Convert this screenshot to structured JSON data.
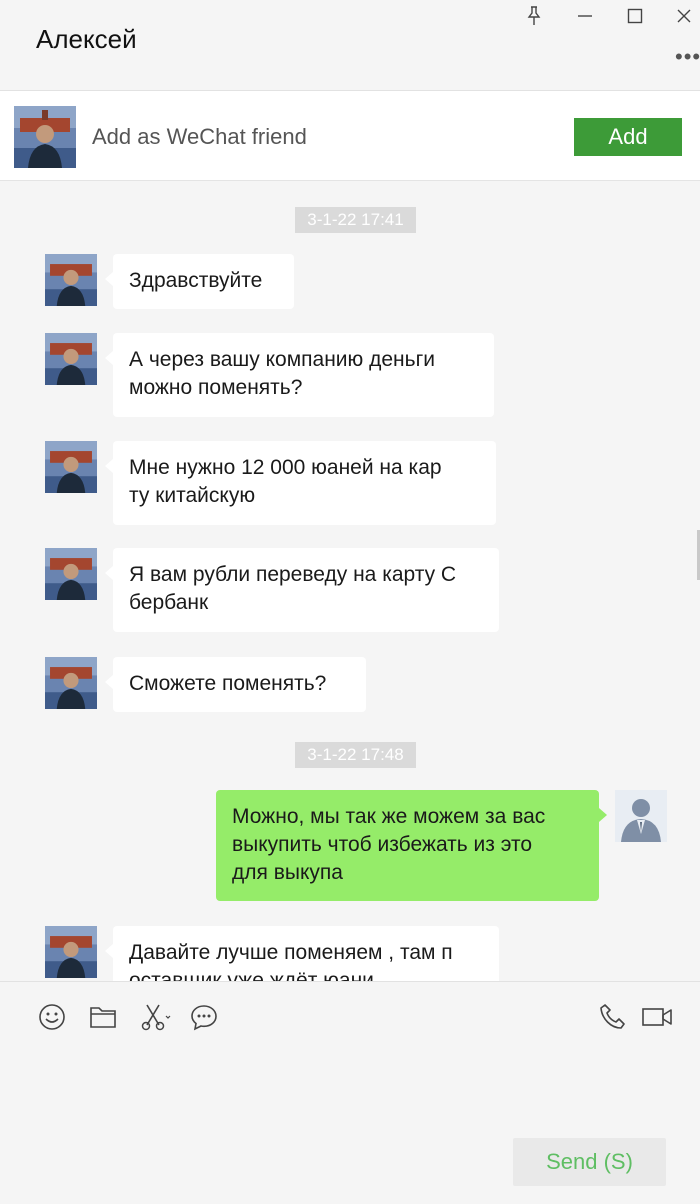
{
  "header": {
    "title": "Алексей",
    "more_label": "•••"
  },
  "icons": {
    "pin": "pin-icon",
    "minimize": "minimize-icon",
    "maximize": "maximize-icon",
    "close": "close-icon",
    "emoji": "emoji-icon",
    "folder": "folder-icon",
    "scissors": "scissors-icon",
    "chat_history": "chat-history-icon",
    "phone": "phone-icon",
    "video": "video-call-icon"
  },
  "add_friend": {
    "label": "Add as WeChat friend",
    "button": "Add"
  },
  "chat": {
    "timestamp_1": "3-1-22 17:41",
    "timestamp_2": "3-1-22 17:48",
    "messages": [
      {
        "from": "contact",
        "text": "Здравствуйте"
      },
      {
        "from": "contact",
        "text": "А через вашу компанию деньги\nможно поменять?"
      },
      {
        "from": "contact",
        "text": "Мне нужно 12 000 юаней на кар\nту китайскую"
      },
      {
        "from": "contact",
        "text": "Я вам рубли переведу на карту С\nбербанк"
      },
      {
        "from": "contact",
        "text": "Сможете поменять?"
      },
      {
        "from": "me",
        "text": "Можно, мы так же можем за вас\n выкупить чтоб избежать из это\nдля выкупа"
      },
      {
        "from": "contact",
        "text": "Давайте лучше поменяем , там п\nоставщик уже ждёт юани"
      }
    ]
  },
  "input": {
    "value": "",
    "send_label": "Send (S)"
  },
  "colors": {
    "accent": "#3d9b38",
    "my_bubble": "#95ec69",
    "send_text": "#5fbe63"
  }
}
